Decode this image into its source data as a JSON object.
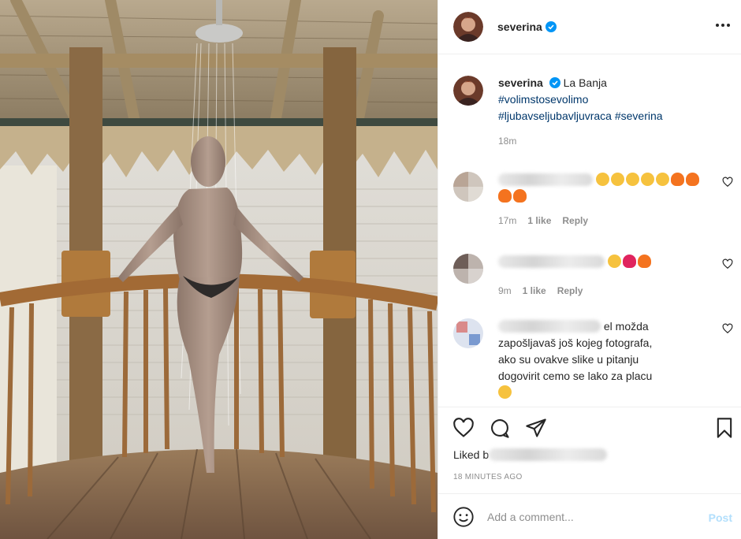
{
  "post": {
    "username": "severina",
    "verified": true,
    "caption": {
      "text": "La Banja",
      "hashtags": [
        "#volimstosevolimo",
        "#ljubavseljubavljuvraca #severina"
      ],
      "time": "18m"
    }
  },
  "comments": [
    {
      "text_visible": "",
      "emojis": [
        "heart-eyes",
        "heart-eyes",
        "heart-eyes",
        "heart-eyes",
        "heart-eyes",
        "fire",
        "fire",
        "fire",
        "fire"
      ],
      "time": "17m",
      "likes": "1 like",
      "reply": "Reply"
    },
    {
      "text_visible": "",
      "emojis": [
        "heart-eyes",
        "red-heart",
        "fire"
      ],
      "time": "9m",
      "likes": "1 like",
      "reply": "Reply"
    },
    {
      "lines": [
        "...el možda",
        "zapošljavaš još kojeg fotografa,",
        "ako su ovakve slike u pitanju",
        "dogovirit cemo se lako za placu"
      ],
      "first_line_suffix": "el možda",
      "emojis": [
        "rofl"
      ]
    }
  ],
  "actions": {
    "liked_by_prefix": "Liked b",
    "time_ago": "18 MINUTES AGO"
  },
  "add_comment": {
    "placeholder": "Add a comment...",
    "post_label": "Post"
  },
  "colors": {
    "verified_blue": "#0095f6",
    "hashtag": "#00376b",
    "muted": "#8e8e8e",
    "post_disabled": "#b2dffc"
  },
  "icons": [
    "verified-badge-icon",
    "more-options-icon",
    "heart-icon",
    "comment-icon",
    "share-icon",
    "bookmark-icon",
    "smile-icon"
  ]
}
